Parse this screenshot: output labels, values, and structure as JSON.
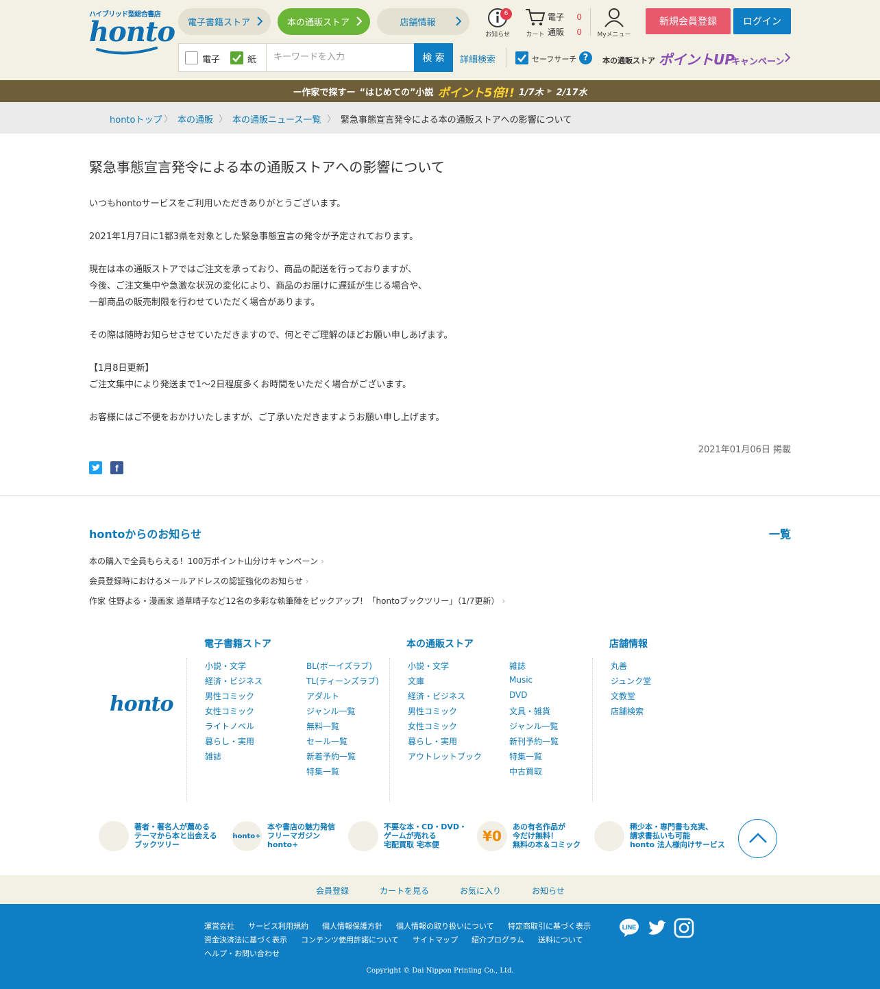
{
  "header": {
    "logo_tagline": "ハイブリッド型総合書店",
    "logo_word": "honto",
    "stores": [
      {
        "label": "電子書籍ストア"
      },
      {
        "label": "本の通販ストア"
      },
      {
        "label": "店舗情報"
      }
    ],
    "notice_label": "お知らせ",
    "notice_count": "6",
    "cart_label": "カート",
    "cart_ebook_label": "電子",
    "cart_ebook_count": "0",
    "cart_paper_label": "通販",
    "cart_paper_count": "0",
    "mymenu_label": "Myメニュー",
    "register_label": "新規会員登録",
    "login_label": "ログイン",
    "search": {
      "ebook_label": "電子",
      "paper_label": "紙",
      "placeholder": "キーワードを入力",
      "button_label": "検 索",
      "advanced_label": "詳細検索",
      "safe_label": "セーフサーチ",
      "help_label": "?"
    },
    "campaign": {
      "prefix": "本の通販ストア",
      "main": "ポイントUP",
      "suffix": "キャンペーン"
    }
  },
  "banner": {
    "prefix": "ー作家で探すー",
    "title": "“はじめての”小説",
    "highlight": "ポイント5倍!!",
    "start": "1/7木",
    "arrow": "▶",
    "end": "2/17水"
  },
  "breadcrumb": [
    {
      "label": "hontoトップ"
    },
    {
      "label": "本の通販"
    },
    {
      "label": "本の通販ニュース一覧"
    },
    {
      "label": "緊急事態宣言発令による本の通販ストアへの影響について"
    }
  ],
  "article": {
    "title": "緊急事態宣言発令による本の通販ストアへの影響について",
    "lines": [
      "いつもhontoサービスをご利用いただきありがとうございます。",
      "2021年1月7日に1都3県を対象とした緊急事態宣言の発令が予定されております。",
      "現在は本の通販ストアではご注文を承っており、商品の配送を行っておりますが、",
      "今後、ご注文集中や急激な状況の変化により、商品のお届けに遅延が生じる場合や、",
      "一部商品の販売制限を行わせていただく場合があります。",
      "その際は随時お知らせさせていただきますので、何とぞご理解のほどお願い申しあげます。",
      "【1月8日更新】",
      "ご注文集中により発送まで1～2日程度多くお時間をいただく場合がございます。",
      "お客様にはご不便をおかけいたしますが、ご了承いただきますようお願い申し上げます。"
    ],
    "posted": "2021年01月06日 掲載"
  },
  "news": {
    "title": "hontoからのお知らせ",
    "all_label": "一覧",
    "items": [
      "本の購入で全員もらえる！100万ポイント山分けキャンペーン",
      "会員登録時におけるメールアドレスの認証強化のお知らせ",
      "作家 住野よる・漫画家 道草晴子など12名の多彩な執筆陣をピックアップ！「hontoブックツリー」（1/7更新）"
    ]
  },
  "footer_nav": {
    "logo": "honto",
    "ebook": {
      "title": "電子書籍ストア",
      "col1": [
        "小説・文学",
        "経済・ビジネス",
        "男性コミック",
        "女性コミック",
        "ライトノベル",
        "暮らし・実用",
        "雑誌"
      ],
      "col2": [
        "BL(ボーイズラブ)",
        "TL(ティーンズラブ)",
        "アダルト",
        "ジャンル一覧",
        "無料一覧",
        "セール一覧",
        "新着予約一覧",
        "特集一覧"
      ]
    },
    "paper": {
      "title": "本の通販ストア",
      "col1": [
        "小説・文学",
        "文庫",
        "経済・ビジネス",
        "男性コミック",
        "女性コミック",
        "暮らし・実用",
        "アウトレットブック"
      ],
      "col2": [
        "雑誌",
        "Music",
        "DVD",
        "文具・雑貨",
        "ジャンル一覧",
        "新刊予約一覧",
        "特集一覧",
        "中古買取"
      ]
    },
    "shop": {
      "title": "店舗情報",
      "col1": [
        "丸善",
        "ジュンク堂",
        "文教堂",
        "店舗検索"
      ]
    }
  },
  "promos": [
    {
      "icon": "",
      "lines": [
        "著者・著名人が薦める",
        "テーマから本と出会える",
        "ブックツリー"
      ]
    },
    {
      "icon": "honto+",
      "lines": [
        "本や書店の魅力発信",
        "フリーマガジン",
        "honto+"
      ]
    },
    {
      "icon": "",
      "lines": [
        "不要な本・CD・DVD・",
        "ゲームが売れる",
        "宅配買取 宅本便"
      ]
    },
    {
      "icon": "¥0",
      "lines": [
        "あの有名作品が",
        "今だけ無料！",
        "無料の本＆コミック"
      ]
    },
    {
      "icon": "",
      "lines": [
        "稀少本・専門書も充実、",
        "請求書払いも可能",
        "honto 法人様向けサービス"
      ]
    }
  ],
  "subfooter": [
    "会員登録",
    "カートを見る",
    "お気に入り",
    "お知らせ"
  ],
  "bottom": {
    "row1": [
      "運営会社",
      "サービス利用規約",
      "個人情報保護方針",
      "個人情報の取り扱いについて",
      "特定商取引に基づく表示"
    ],
    "row2": [
      "資金決済法に基づく表示",
      "コンテンツ使用許諾について",
      "サイトマップ",
      "紹介プログラム",
      "送料について"
    ],
    "row3": [
      "ヘルプ・お問い合わせ"
    ],
    "line_label": "LINE",
    "copyright": "Copyright © Dai Nippon Printing Co., Ltd."
  },
  "colors": {
    "header_bg": "#f3f1e4",
    "brand_blue": "#0f7ec4",
    "honto_green": "#6ab535",
    "register_pink": "#e9596e",
    "banner_brown": "#6f5e3a",
    "campaign_purple": "#8a4db2"
  }
}
